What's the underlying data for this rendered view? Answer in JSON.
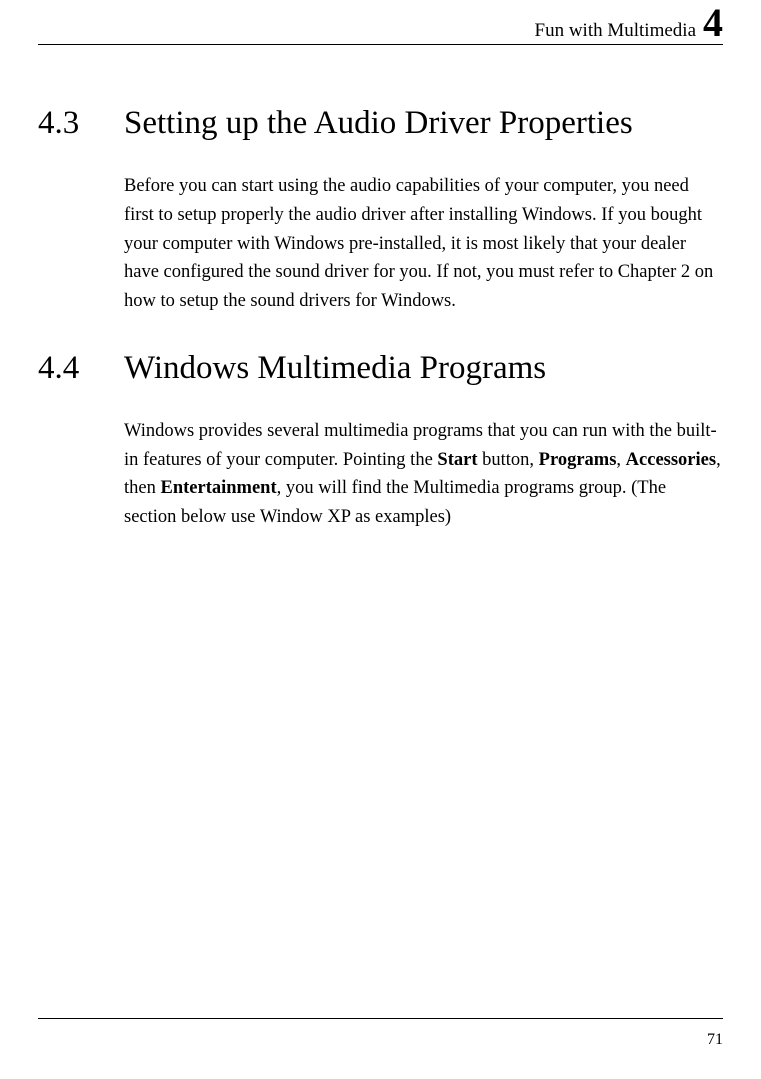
{
  "header": {
    "title": "Fun with Multimedia",
    "chapter": "4"
  },
  "sections": [
    {
      "num": "4.3",
      "title": "Setting up the Audio Driver Properties",
      "body_plain": "Before you can start using the audio capabilities of your computer, you need first to setup properly the audio driver after installing Windows. If you bought your computer with Windows pre-installed, it is most likely that your dealer have configured the sound driver for you. If not, you must refer to Chapter 2 on how to setup the sound drivers for Windows."
    },
    {
      "num": "4.4",
      "title": "Windows Multimedia Programs",
      "body_parts": {
        "p1": "Windows provides several multimedia programs that you can run with the built-in features of your computer. Pointing the ",
        "b1": "Start",
        "p2": " button, ",
        "b2": "Programs",
        "p3": ", ",
        "b3": "Accessories",
        "p4": ", then ",
        "b4": "Entertainment",
        "p5": ", you will find the Multimedia programs group. (The section below use Window XP as examples)"
      }
    }
  ],
  "page_number": "71"
}
